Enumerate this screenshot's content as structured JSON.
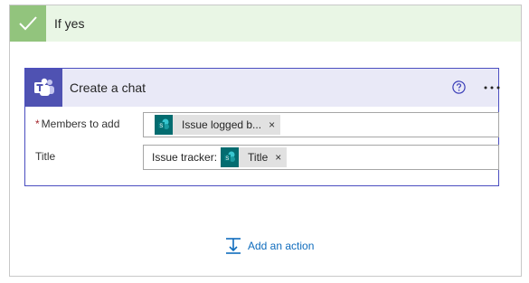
{
  "branch": {
    "title": "If yes"
  },
  "action_card": {
    "title": "Create a chat",
    "icons": {
      "app": "teams-icon",
      "help": "help-icon",
      "more": "more-options-icon"
    },
    "fields": [
      {
        "label": "Members to add",
        "required": true,
        "prefix_text": "",
        "token": {
          "label": "Issue logged b...",
          "icon": "sharepoint-icon",
          "remove": "×"
        }
      },
      {
        "label": "Title",
        "required": false,
        "prefix_text": "Issue tracker:",
        "token": {
          "label": "Title",
          "icon": "sharepoint-icon",
          "remove": "×"
        }
      }
    ]
  },
  "add_action": {
    "label": "Add an action",
    "icon": "add-action-icon"
  },
  "colors": {
    "branch_header_bg": "#e9f6e5",
    "check_green": "#92c47d",
    "teams_purple": "#4f52b2",
    "card_border": "#4b4ec0",
    "card_header_bg": "#e9e9f7",
    "sharepoint_teal": "#036c70",
    "link_blue": "#0f6cbd"
  }
}
